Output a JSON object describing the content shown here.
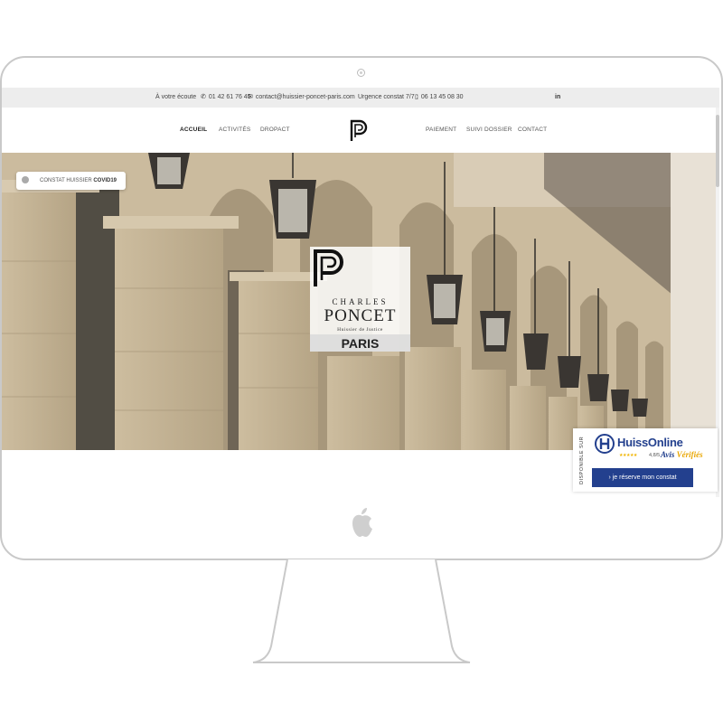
{
  "topbar": {
    "listening": "À votre écoute",
    "phone": "01 42 61 76 45",
    "email": "contact@huissier-poncet-paris.com",
    "urgence": "Urgence constat 7/7 :",
    "mobile": "06 13 45 08 30",
    "linkedin_label": "in"
  },
  "nav": {
    "left": [
      "ACCUEIL",
      "ACTIVITÉS",
      "DROPACT"
    ],
    "right": [
      "PAIEMENT",
      "SUIVI DOSSIER",
      "CONTACT"
    ],
    "active": "ACCUEIL"
  },
  "hero": {
    "covid_prefix": "CONSTAT HUISSIER ",
    "covid_strong": "COVID19",
    "card": {
      "line1": "CHARLES",
      "line2": "PONCET",
      "line3": "Huissier de Justice",
      "line4": "PARIS"
    }
  },
  "huissonline": {
    "side_text": "DISPONIBLE SUR",
    "brand": "HuissOnline",
    "stars": "★★★★★",
    "rating": "4,8/5",
    "avis": "Avis",
    "verifies": "Vérifiés",
    "cta": "› je réserve mon constat"
  },
  "colors": {
    "accent": "#23408e",
    "stars": "#f1b400",
    "topbar_bg": "#ededed"
  },
  "icons": {
    "phone": "phone-icon",
    "email": "mail-icon",
    "mobile": "mobile-icon",
    "linkedin": "linkedin-icon",
    "apple": "apple-icon"
  }
}
